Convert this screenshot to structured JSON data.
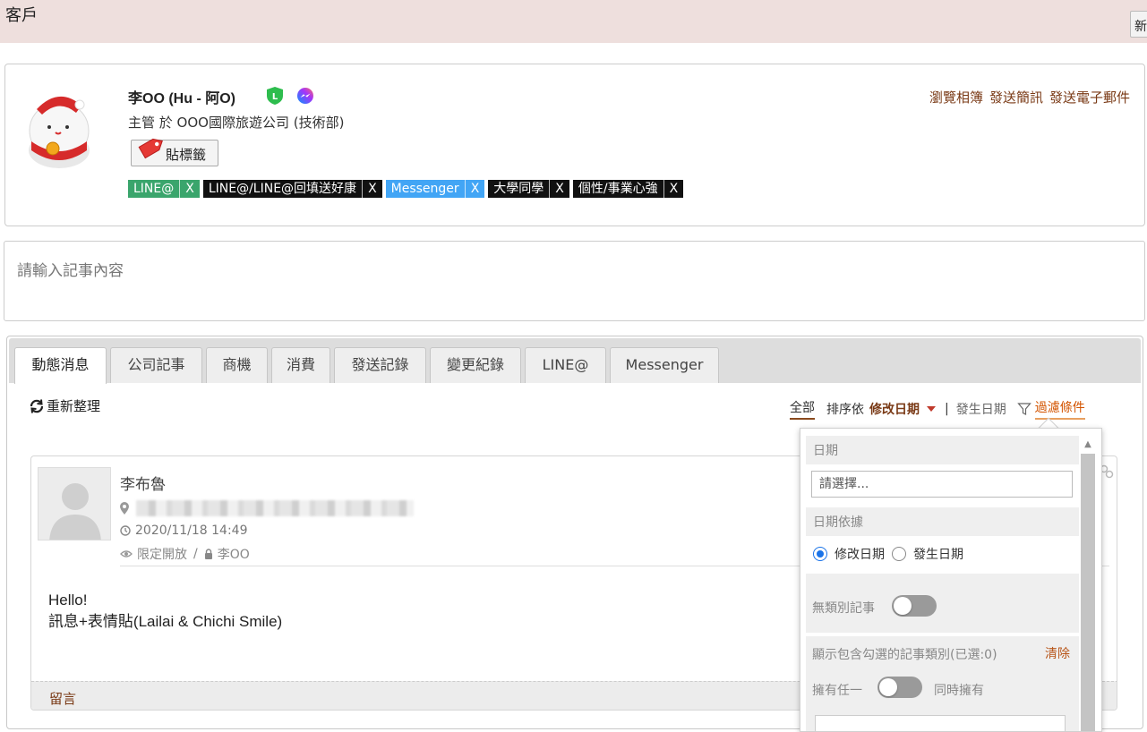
{
  "header": {
    "title": "客戶",
    "new_button_label": "新"
  },
  "profile": {
    "name": "李OO (Hu - 阿O)",
    "title": "主管 於 OOO國際旅遊公司 (技術部)",
    "tag_button_label": "貼標籤",
    "actions": [
      "瀏覽相簿",
      "發送簡訊",
      "發送電子郵件"
    ],
    "tags": [
      {
        "label": "LINE@",
        "x": "X",
        "color": "#3aa56c"
      },
      {
        "label": "LINE@/LINE@回填送好康",
        "x": "X",
        "color": "#111111"
      },
      {
        "label": "Messenger",
        "x": "X",
        "color": "#42a5f5"
      },
      {
        "label": "大學同學",
        "x": "X",
        "color": "#111111"
      },
      {
        "label": "個性/事業心強",
        "x": "X",
        "color": "#111111"
      }
    ]
  },
  "note": {
    "placeholder": "請輸入記事內容"
  },
  "tabs": [
    {
      "label": "動態消息",
      "active": true
    },
    {
      "label": "公司記事"
    },
    {
      "label": "商機"
    },
    {
      "label": "消費"
    },
    {
      "label": "發送記錄"
    },
    {
      "label": "變更紀錄"
    },
    {
      "label": "LINE@"
    },
    {
      "label": "Messenger"
    }
  ],
  "toolbar": {
    "refresh_label": "重新整理",
    "all_label": "全部",
    "sort_by_label": "排序依",
    "sort_modified": "修改日期",
    "separator": "|",
    "sort_occurred": "發生日期",
    "filter_label": "過濾條件"
  },
  "post": {
    "author": "李布魯",
    "time": "2020/11/18 14:49",
    "visibility": "限定開放",
    "visibility_sep": "/",
    "owner": "李OO",
    "body_line1": "Hello!",
    "body_line2": "訊息+表情貼(Lailai & Chichi Smile)",
    "comment_label": "留言"
  },
  "filter_panel": {
    "date_label": "日期",
    "date_placeholder": "請選擇...",
    "date_basis_label": "日期依據",
    "radio_modified": "修改日期",
    "radio_occurred": "發生日期",
    "no_category_label": "無類別記事",
    "category_label": "顯示包含勾選的記事類別(已選:0)",
    "clear_label": "清除",
    "any_label": "擁有任一",
    "all_label": "同時擁有"
  },
  "colors": {
    "accent": "#7a3a16",
    "filter_accent": "#d35400",
    "radio_blue": "#1a73e8"
  }
}
